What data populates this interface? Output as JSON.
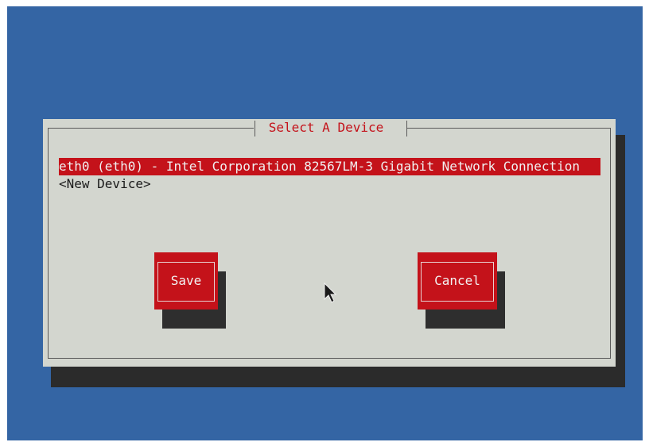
{
  "dialog": {
    "title": "Select A Device",
    "devices": [
      {
        "label": "eth0 (eth0) - Intel Corporation 82567LM-3 Gigabit Network Connection",
        "selected": true
      },
      {
        "label": "<New Device>",
        "selected": false
      }
    ],
    "buttons": {
      "save_label": "Save",
      "cancel_label": "Cancel"
    }
  },
  "colors": {
    "background": "#3465a4",
    "dialog": "#d3d6cf",
    "accent": "#c4121a",
    "shadow": "#2b2b2b"
  },
  "icons": {
    "cursor": "mouse-pointer-icon"
  }
}
